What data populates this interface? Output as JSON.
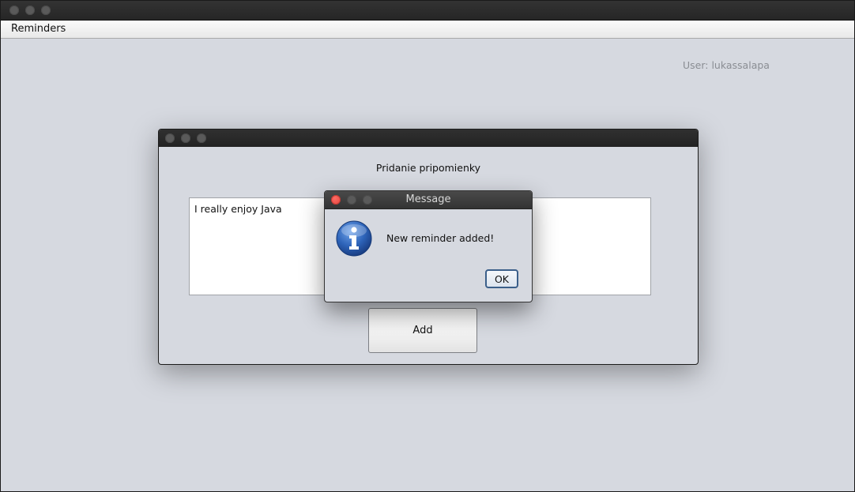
{
  "menubar": {
    "items": [
      {
        "label": "Reminders"
      }
    ]
  },
  "main": {
    "user_label": "User: lukassalapa"
  },
  "add_window": {
    "heading": "Pridanie pripomienky",
    "text_value": "I really enjoy Java",
    "add_label": "Add"
  },
  "message_dialog": {
    "title": "Message",
    "text": "New reminder added!",
    "ok_label": "OK",
    "icon": "info-icon"
  },
  "colors": {
    "background": "#d6d9e0",
    "titlebar": "#262626",
    "close_button": "#e0443e",
    "info_icon": "#2a5db0"
  }
}
